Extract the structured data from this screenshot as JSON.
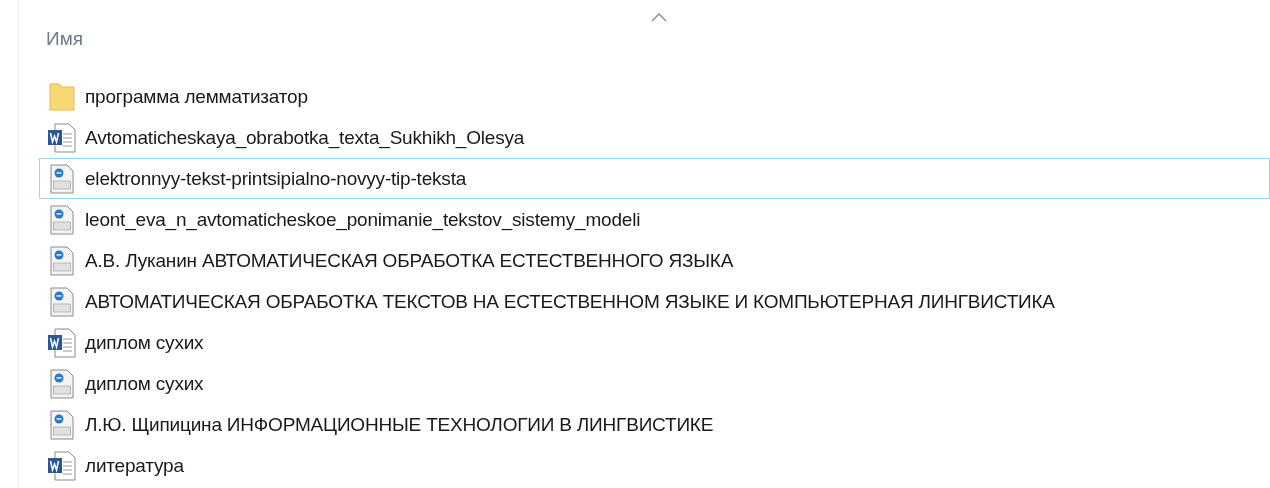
{
  "column_header": {
    "label": "Имя",
    "sorted_ascending": true
  },
  "files": [
    {
      "name": "программа лемматизатор",
      "kind": "folder",
      "focused": false
    },
    {
      "name": "Avtomaticheskaya_obrabotka_texta_Sukhikh_Olesya",
      "kind": "word",
      "focused": false
    },
    {
      "name": "elektronnyy-tekst-printsipialno-novyy-tip-teksta",
      "kind": "pdf",
      "focused": true
    },
    {
      "name": "leont_eva_n_avtomaticheskoe_ponimanie_tekstov_sistemy_modeli",
      "kind": "pdf",
      "focused": false
    },
    {
      "name": "А.В. Луканин АВТОМАТИЧЕСКАЯ ОБРАБОТКА ЕСТЕСТВЕННОГО ЯЗЫКА",
      "kind": "pdf",
      "focused": false
    },
    {
      "name": "АВТОМАТИЧЕСКАЯ ОБРАБОТКА ТЕКСТОВ НА ЕСТЕСТВЕННОМ ЯЗЫКЕ И КОМПЬЮТЕРНАЯ ЛИНГВИСТИКА",
      "kind": "pdf",
      "focused": false
    },
    {
      "name": "диплом сухих",
      "kind": "word",
      "focused": false
    },
    {
      "name": "диплом сухих",
      "kind": "pdf",
      "focused": false
    },
    {
      "name": "Л.Ю. Щипицина ИНФОРМАЦИОННЫЕ ТЕХНОЛОГИИ В ЛИНГВИСТИКЕ",
      "kind": "pdf",
      "focused": false
    },
    {
      "name": "литература",
      "kind": "word",
      "focused": false
    }
  ]
}
